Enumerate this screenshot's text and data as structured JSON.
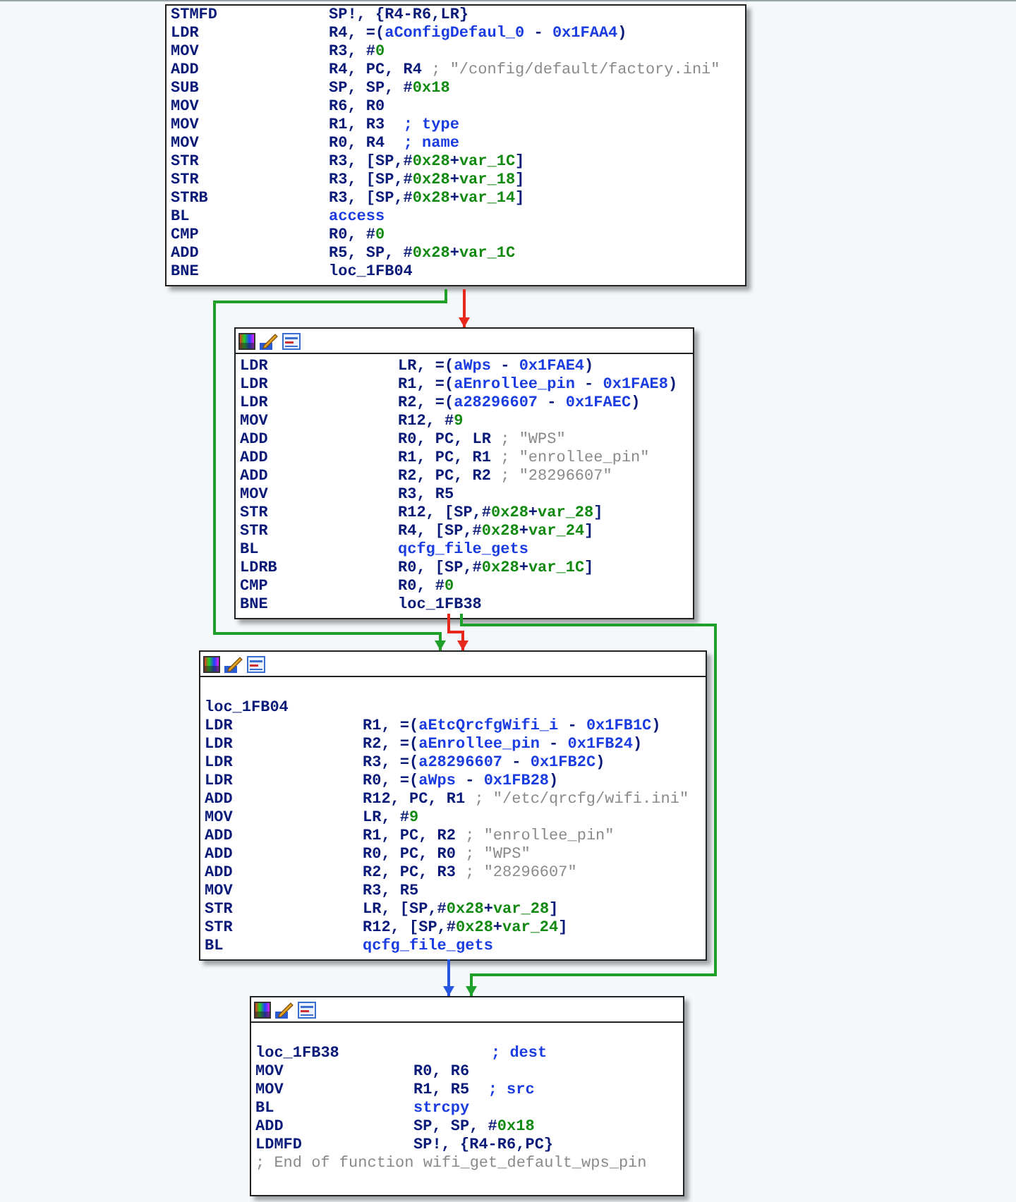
{
  "nodes": [
    {
      "toolbar": false,
      "lines": [
        {
          "mnemonic": "STMFD",
          "operands": [
            {
              "text": "SP!, {R4-R6,LR}",
              "kind": "plain"
            }
          ]
        },
        {
          "mnemonic": "LDR",
          "operands": [
            {
              "text": "R4, =(",
              "kind": "plain"
            },
            {
              "text": "aConfigDefaul_0",
              "kind": "name"
            },
            {
              "text": " - ",
              "kind": "plain"
            },
            {
              "text": "0x1FAA4",
              "kind": "name"
            },
            {
              "text": ")",
              "kind": "plain"
            }
          ]
        },
        {
          "mnemonic": "MOV",
          "operands": [
            {
              "text": "R3, #",
              "kind": "plain"
            },
            {
              "text": "0",
              "kind": "num"
            }
          ]
        },
        {
          "mnemonic": "ADD",
          "operands": [
            {
              "text": "R4, PC, R4 ",
              "kind": "plain"
            }
          ],
          "comment": {
            "text": "; \"/config/default/factory.ini\"",
            "kind": "string"
          }
        },
        {
          "mnemonic": "SUB",
          "operands": [
            {
              "text": "SP, SP, #",
              "kind": "plain"
            },
            {
              "text": "0x18",
              "kind": "num"
            }
          ]
        },
        {
          "mnemonic": "MOV",
          "operands": [
            {
              "text": "R6, R0",
              "kind": "plain"
            }
          ]
        },
        {
          "mnemonic": "MOV",
          "operands": [
            {
              "text": "R1, R3  ",
              "kind": "plain"
            }
          ],
          "comment": {
            "text": "; type",
            "kind": "name"
          }
        },
        {
          "mnemonic": "MOV",
          "operands": [
            {
              "text": "R0, R4  ",
              "kind": "plain"
            }
          ],
          "comment": {
            "text": "; name",
            "kind": "name"
          }
        },
        {
          "mnemonic": "STR",
          "operands": [
            {
              "text": "R3, [SP,#",
              "kind": "plain"
            },
            {
              "text": "0x28",
              "kind": "num"
            },
            {
              "text": "+",
              "kind": "plain"
            },
            {
              "text": "var_1C",
              "kind": "num"
            },
            {
              "text": "]",
              "kind": "plain"
            }
          ]
        },
        {
          "mnemonic": "STR",
          "operands": [
            {
              "text": "R3, [SP,#",
              "kind": "plain"
            },
            {
              "text": "0x28",
              "kind": "num"
            },
            {
              "text": "+",
              "kind": "plain"
            },
            {
              "text": "var_18",
              "kind": "num"
            },
            {
              "text": "]",
              "kind": "plain"
            }
          ]
        },
        {
          "mnemonic": "STRB",
          "operands": [
            {
              "text": "R3, [SP,#",
              "kind": "plain"
            },
            {
              "text": "0x28",
              "kind": "num"
            },
            {
              "text": "+",
              "kind": "plain"
            },
            {
              "text": "var_14",
              "kind": "num"
            },
            {
              "text": "]",
              "kind": "plain"
            }
          ]
        },
        {
          "mnemonic": "BL",
          "operands": [
            {
              "text": "access",
              "kind": "name"
            }
          ]
        },
        {
          "mnemonic": "CMP",
          "operands": [
            {
              "text": "R0, #",
              "kind": "plain"
            },
            {
              "text": "0",
              "kind": "num"
            }
          ]
        },
        {
          "mnemonic": "ADD",
          "operands": [
            {
              "text": "R5, SP, #",
              "kind": "plain"
            },
            {
              "text": "0x28",
              "kind": "num"
            },
            {
              "text": "+",
              "kind": "plain"
            },
            {
              "text": "var_1C",
              "kind": "num"
            }
          ]
        },
        {
          "mnemonic": "BNE",
          "operands": [
            {
              "text": "loc_1FB04",
              "kind": "plain"
            }
          ]
        }
      ]
    },
    {
      "toolbar": true,
      "lines": [
        {
          "mnemonic": "LDR",
          "operands": [
            {
              "text": "LR, =(",
              "kind": "plain"
            },
            {
              "text": "aWps",
              "kind": "name"
            },
            {
              "text": " - ",
              "kind": "plain"
            },
            {
              "text": "0x1FAE4",
              "kind": "name"
            },
            {
              "text": ")",
              "kind": "plain"
            }
          ]
        },
        {
          "mnemonic": "LDR",
          "operands": [
            {
              "text": "R1, =(",
              "kind": "plain"
            },
            {
              "text": "aEnrollee_pin",
              "kind": "name"
            },
            {
              "text": " - ",
              "kind": "plain"
            },
            {
              "text": "0x1FAE8",
              "kind": "name"
            },
            {
              "text": ")",
              "kind": "plain"
            }
          ]
        },
        {
          "mnemonic": "LDR",
          "operands": [
            {
              "text": "R2, =(",
              "kind": "plain"
            },
            {
              "text": "a28296607",
              "kind": "name"
            },
            {
              "text": " - ",
              "kind": "plain"
            },
            {
              "text": "0x1FAEC",
              "kind": "name"
            },
            {
              "text": ")",
              "kind": "plain"
            }
          ]
        },
        {
          "mnemonic": "MOV",
          "operands": [
            {
              "text": "R12, #",
              "kind": "plain"
            },
            {
              "text": "9",
              "kind": "num"
            }
          ]
        },
        {
          "mnemonic": "ADD",
          "operands": [
            {
              "text": "R0, PC, LR ",
              "kind": "plain"
            }
          ],
          "comment": {
            "text": "; \"WPS\"",
            "kind": "string"
          }
        },
        {
          "mnemonic": "ADD",
          "operands": [
            {
              "text": "R1, PC, R1 ",
              "kind": "plain"
            }
          ],
          "comment": {
            "text": "; \"enrollee_pin\"",
            "kind": "string"
          }
        },
        {
          "mnemonic": "ADD",
          "operands": [
            {
              "text": "R2, PC, R2 ",
              "kind": "plain"
            }
          ],
          "comment": {
            "text": "; \"28296607\"",
            "kind": "string"
          }
        },
        {
          "mnemonic": "MOV",
          "operands": [
            {
              "text": "R3, R5",
              "kind": "plain"
            }
          ]
        },
        {
          "mnemonic": "STR",
          "operands": [
            {
              "text": "R12, [SP,#",
              "kind": "plain"
            },
            {
              "text": "0x28",
              "kind": "num"
            },
            {
              "text": "+",
              "kind": "plain"
            },
            {
              "text": "var_28",
              "kind": "num"
            },
            {
              "text": "]",
              "kind": "plain"
            }
          ]
        },
        {
          "mnemonic": "STR",
          "operands": [
            {
              "text": "R4, [SP,#",
              "kind": "plain"
            },
            {
              "text": "0x28",
              "kind": "num"
            },
            {
              "text": "+",
              "kind": "plain"
            },
            {
              "text": "var_24",
              "kind": "num"
            },
            {
              "text": "]",
              "kind": "plain"
            }
          ]
        },
        {
          "mnemonic": "BL",
          "operands": [
            {
              "text": "qcfg_file_gets",
              "kind": "name"
            }
          ]
        },
        {
          "mnemonic": "LDRB",
          "operands": [
            {
              "text": "R0, [SP,#",
              "kind": "plain"
            },
            {
              "text": "0x28",
              "kind": "num"
            },
            {
              "text": "+",
              "kind": "plain"
            },
            {
              "text": "var_1C",
              "kind": "num"
            },
            {
              "text": "]",
              "kind": "plain"
            }
          ]
        },
        {
          "mnemonic": "CMP",
          "operands": [
            {
              "text": "R0, #",
              "kind": "plain"
            },
            {
              "text": "0",
              "kind": "num"
            }
          ]
        },
        {
          "mnemonic": "BNE",
          "operands": [
            {
              "text": "loc_1FB38",
              "kind": "plain"
            }
          ]
        }
      ]
    },
    {
      "toolbar": true,
      "lines": [
        {
          "label": "loc_1FB04"
        },
        {
          "mnemonic": "LDR",
          "operands": [
            {
              "text": "R1, =(",
              "kind": "plain"
            },
            {
              "text": "aEtcQrcfgWifi_i",
              "kind": "name"
            },
            {
              "text": " - ",
              "kind": "plain"
            },
            {
              "text": "0x1FB1C",
              "kind": "name"
            },
            {
              "text": ")",
              "kind": "plain"
            }
          ]
        },
        {
          "mnemonic": "LDR",
          "operands": [
            {
              "text": "R2, =(",
              "kind": "plain"
            },
            {
              "text": "aEnrollee_pin",
              "kind": "name"
            },
            {
              "text": " - ",
              "kind": "plain"
            },
            {
              "text": "0x1FB24",
              "kind": "name"
            },
            {
              "text": ")",
              "kind": "plain"
            }
          ]
        },
        {
          "mnemonic": "LDR",
          "operands": [
            {
              "text": "R3, =(",
              "kind": "plain"
            },
            {
              "text": "a28296607",
              "kind": "name"
            },
            {
              "text": " - ",
              "kind": "plain"
            },
            {
              "text": "0x1FB2C",
              "kind": "name"
            },
            {
              "text": ")",
              "kind": "plain"
            }
          ]
        },
        {
          "mnemonic": "LDR",
          "operands": [
            {
              "text": "R0, =(",
              "kind": "plain"
            },
            {
              "text": "aWps",
              "kind": "name"
            },
            {
              "text": " - ",
              "kind": "plain"
            },
            {
              "text": "0x1FB28",
              "kind": "name"
            },
            {
              "text": ")",
              "kind": "plain"
            }
          ]
        },
        {
          "mnemonic": "ADD",
          "operands": [
            {
              "text": "R12, PC, R1 ",
              "kind": "plain"
            }
          ],
          "comment": {
            "text": "; \"/etc/qrcfg/wifi.ini\"",
            "kind": "string"
          }
        },
        {
          "mnemonic": "MOV",
          "operands": [
            {
              "text": "LR, #",
              "kind": "plain"
            },
            {
              "text": "9",
              "kind": "num"
            }
          ]
        },
        {
          "mnemonic": "ADD",
          "operands": [
            {
              "text": "R1, PC, R2 ",
              "kind": "plain"
            }
          ],
          "comment": {
            "text": "; \"enrollee_pin\"",
            "kind": "string"
          }
        },
        {
          "mnemonic": "ADD",
          "operands": [
            {
              "text": "R0, PC, R0 ",
              "kind": "plain"
            }
          ],
          "comment": {
            "text": "; \"WPS\"",
            "kind": "string"
          }
        },
        {
          "mnemonic": "ADD",
          "operands": [
            {
              "text": "R2, PC, R3 ",
              "kind": "plain"
            }
          ],
          "comment": {
            "text": "; \"28296607\"",
            "kind": "string"
          }
        },
        {
          "mnemonic": "MOV",
          "operands": [
            {
              "text": "R3, R5",
              "kind": "plain"
            }
          ]
        },
        {
          "mnemonic": "STR",
          "operands": [
            {
              "text": "LR, [SP,#",
              "kind": "plain"
            },
            {
              "text": "0x28",
              "kind": "num"
            },
            {
              "text": "+",
              "kind": "plain"
            },
            {
              "text": "var_28",
              "kind": "num"
            },
            {
              "text": "]",
              "kind": "plain"
            }
          ]
        },
        {
          "mnemonic": "STR",
          "operands": [
            {
              "text": "R12, [SP,#",
              "kind": "plain"
            },
            {
              "text": "0x28",
              "kind": "num"
            },
            {
              "text": "+",
              "kind": "plain"
            },
            {
              "text": "var_24",
              "kind": "num"
            },
            {
              "text": "]",
              "kind": "plain"
            }
          ]
        },
        {
          "mnemonic": "BL",
          "operands": [
            {
              "text": "qcfg_file_gets",
              "kind": "name"
            }
          ]
        }
      ]
    },
    {
      "toolbar": true,
      "lines": [
        {
          "label": "loc_1FB38",
          "comment": {
            "text": "; dest",
            "kind": "name"
          }
        },
        {
          "mnemonic": "MOV",
          "operands": [
            {
              "text": "R0, R6",
              "kind": "plain"
            }
          ]
        },
        {
          "mnemonic": "MOV",
          "operands": [
            {
              "text": "R1, R5  ",
              "kind": "plain"
            }
          ],
          "comment": {
            "text": "; src",
            "kind": "name"
          }
        },
        {
          "mnemonic": "BL",
          "operands": [
            {
              "text": "strcpy",
              "kind": "name"
            }
          ]
        },
        {
          "mnemonic": "ADD",
          "operands": [
            {
              "text": "SP, SP, #",
              "kind": "plain"
            },
            {
              "text": "0x18",
              "kind": "num"
            }
          ]
        },
        {
          "mnemonic": "LDMFD",
          "operands": [
            {
              "text": "SP!, {R4-R6,PC}",
              "kind": "plain"
            }
          ]
        },
        {
          "comment": {
            "text": "; End of function wifi_get_default_wps_pin",
            "kind": "string"
          }
        }
      ]
    }
  ],
  "edges": [
    {
      "color": "#e8281d"
    },
    {
      "color": "#1fa02a"
    },
    {
      "color": "#e8281d"
    },
    {
      "color": "#1fa02a"
    },
    {
      "color": "#2456e0"
    }
  ]
}
